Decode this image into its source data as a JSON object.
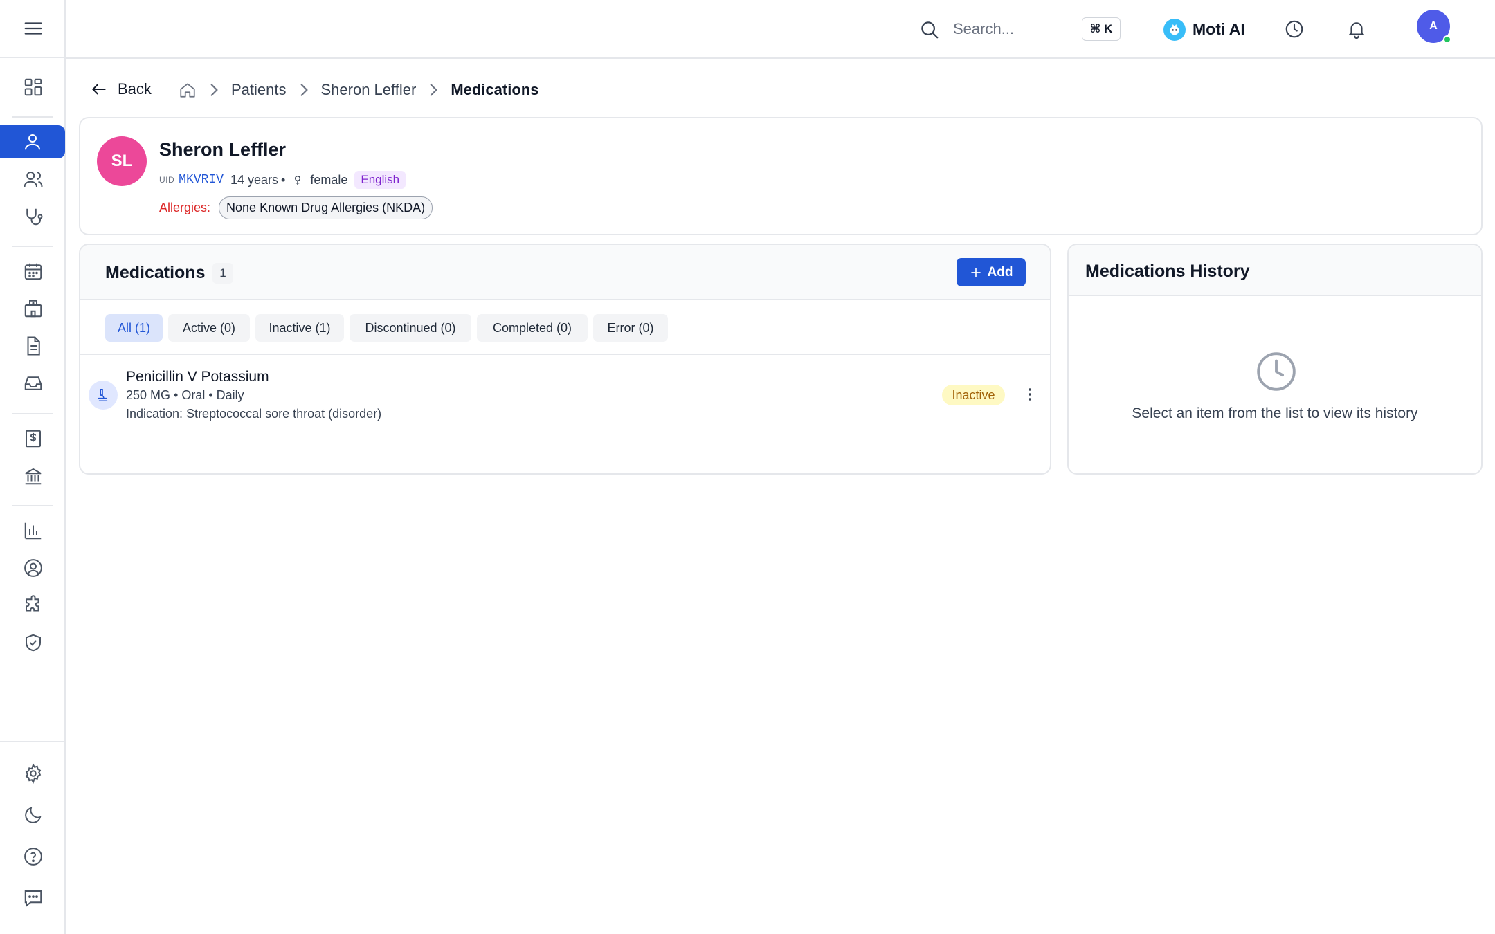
{
  "sidebar": {
    "menu_icon": "hamburger-icon",
    "items": [
      {
        "name": "dashboard",
        "icon": "grid-icon"
      },
      {
        "name": "patient",
        "icon": "user-icon",
        "active": true
      },
      {
        "name": "patients",
        "icon": "users-icon"
      },
      {
        "name": "clinical",
        "icon": "stethoscope-icon"
      },
      {
        "name": "calendar",
        "icon": "calendar-icon"
      },
      {
        "name": "facilities",
        "icon": "hospital-icon"
      },
      {
        "name": "documents",
        "icon": "document-icon"
      },
      {
        "name": "inbox",
        "icon": "inbox-icon"
      },
      {
        "name": "billing",
        "icon": "invoice-icon"
      },
      {
        "name": "bank",
        "icon": "bank-icon"
      },
      {
        "name": "reports",
        "icon": "bar-chart-icon"
      },
      {
        "name": "account",
        "icon": "user-circle-icon"
      },
      {
        "name": "integrations",
        "icon": "puzzle-icon"
      },
      {
        "name": "security",
        "icon": "shield-check-icon"
      },
      {
        "name": "settings",
        "icon": "gear-icon"
      },
      {
        "name": "theme",
        "icon": "moon-icon"
      },
      {
        "name": "help",
        "icon": "help-circle-icon"
      },
      {
        "name": "feedback",
        "icon": "chat-icon"
      }
    ]
  },
  "topbar": {
    "search_placeholder": "Search...",
    "shortcut": "⌘ K",
    "ai_label": "Moti AI",
    "user_initial": "A",
    "accent": "#2156d6"
  },
  "breadcrumb": {
    "back_label": "Back",
    "items": [
      "Patients",
      "Sheron Leffler"
    ],
    "current": "Medications"
  },
  "patient": {
    "initials": "SL",
    "name": "Sheron Leffler",
    "uid_label": "UID",
    "uid": "MKVRIV",
    "age": "14 years",
    "separator": "•",
    "gender": "female",
    "language": "English",
    "allergies_label": "Allergies:",
    "allergy": "None Known Drug Allergies (NKDA)",
    "avatar_color": "#ec4899"
  },
  "medications": {
    "title": "Medications",
    "count": "1",
    "add_label": "Add",
    "tabs": [
      {
        "label": "All (1)",
        "active": true
      },
      {
        "label": "Active (0)"
      },
      {
        "label": "Inactive (1)"
      },
      {
        "label": "Discontinued (0)"
      },
      {
        "label": "Completed (0)"
      },
      {
        "label": "Error (0)"
      }
    ],
    "items": [
      {
        "name": "Penicillin V Potassium",
        "details": "250 MG • Oral • Daily",
        "indication": "Indication: Streptococcal sore throat (disorder)",
        "status": "Inactive"
      }
    ]
  },
  "history": {
    "title": "Medications History",
    "empty_text": "Select an item from the list to view its history"
  }
}
